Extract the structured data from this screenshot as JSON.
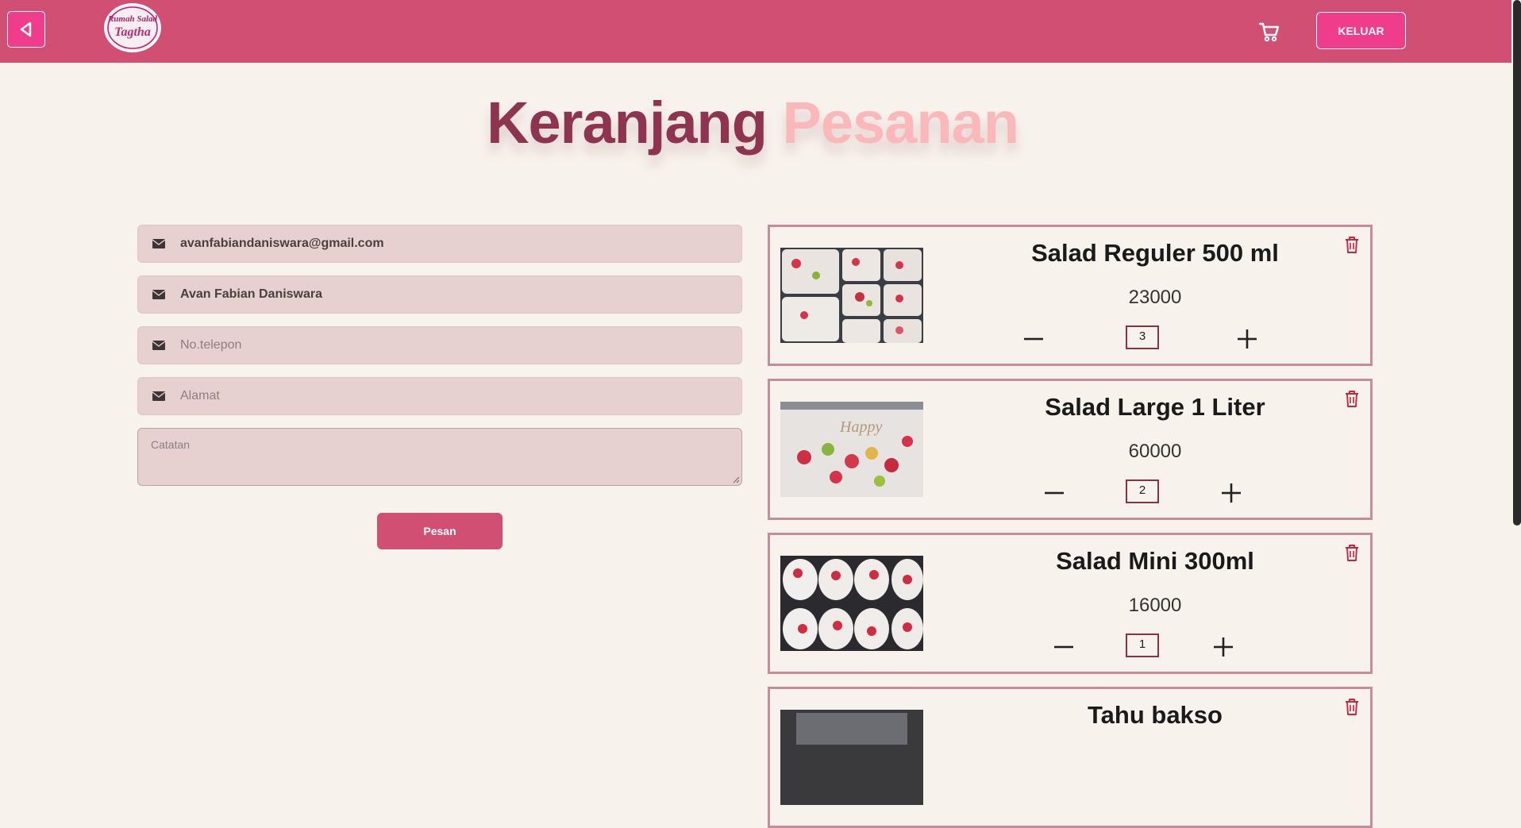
{
  "header": {
    "logo_text_line1": "Rumah Salad",
    "logo_text_line2": "Tagtha",
    "logout_label": "KELUAR",
    "colors": {
      "bar": "#d24f74",
      "button": "#ef3d8c"
    }
  },
  "title": {
    "word1": "Keranjang",
    "word2": "Pesanan"
  },
  "form": {
    "email_value": "avanfabiandaniswara@gmail.com",
    "name_value": "Avan Fabian Daniswara",
    "phone_placeholder": "No.telepon",
    "address_placeholder": "Alamat",
    "notes_placeholder": "Catatan",
    "submit_label": "Pesan",
    "field_icon": "envelope-icon"
  },
  "cart": {
    "items": [
      {
        "name": "Salad Reguler 500 ml",
        "price": "23000",
        "qty": "3"
      },
      {
        "name": "Salad Large 1 Liter",
        "price": "60000",
        "qty": "2"
      },
      {
        "name": "Salad Mini 300ml",
        "price": "16000",
        "qty": "1"
      },
      {
        "name": "Tahu bakso",
        "price": "",
        "qty": ""
      }
    ],
    "icons": {
      "remove": "trash-icon",
      "decrease": "minus-icon",
      "increase": "plus-icon"
    }
  }
}
